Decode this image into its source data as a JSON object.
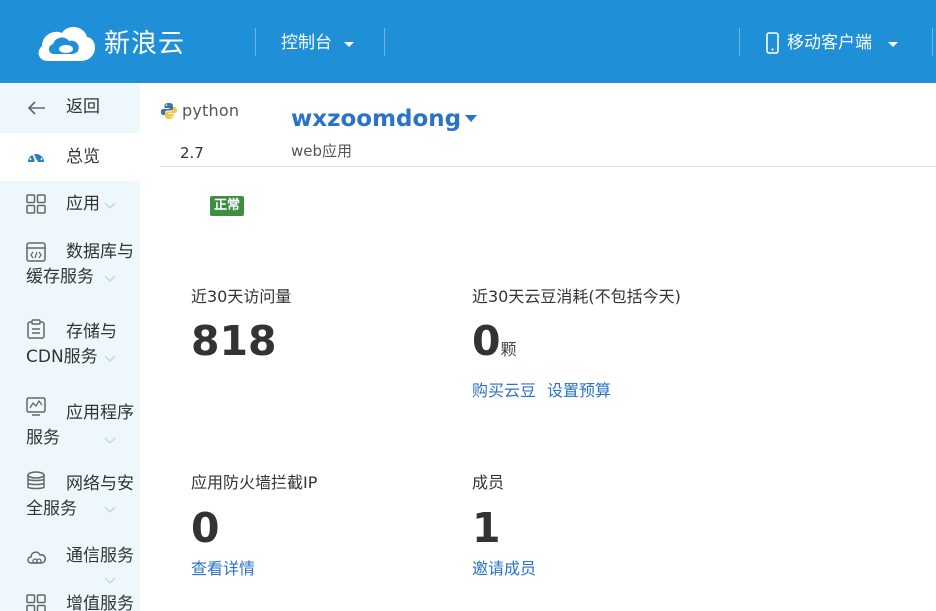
{
  "header": {
    "brand": "新浪云",
    "console_label": "控制台",
    "mobile_label": "移动客户端",
    "bg_color": "#1f8fd8"
  },
  "sidebar": {
    "bg_color": "#eef8fc",
    "items": [
      {
        "label": "返回",
        "icon": "back-arrow-icon"
      },
      {
        "label": "总览",
        "icon": "dashboard-icon",
        "active": true
      },
      {
        "label": "应用",
        "icon": "grid-icon"
      },
      {
        "label_line1": "数据库与",
        "label_line2": "缓存服务",
        "icon": "database-code-icon"
      },
      {
        "label_line1": "存储与",
        "label_line2": "CDN服务",
        "icon": "clipboard-icon"
      },
      {
        "label_line1": "应用程序",
        "label_line2": "服务",
        "icon": "chart-monitor-icon"
      },
      {
        "label_line1": "网络与安",
        "label_line2": "全服务",
        "icon": "database-stack-icon"
      },
      {
        "label": "通信服务",
        "icon": "cloud-link-icon"
      },
      {
        "label": "增值服务",
        "icon": "grid-icon"
      }
    ]
  },
  "app": {
    "runtime": "python",
    "version": "2.7",
    "name": "wxzoomdong",
    "type": "web应用",
    "status": "正常",
    "status_color": "#3e8d40",
    "link_color": "#2a73c5"
  },
  "stats": {
    "visits_label": "近30天访问量",
    "visits_value": "818",
    "beans_label": "近30天云豆消耗(不包括今天)",
    "beans_value": "0",
    "beans_unit": "颗",
    "buy_beans": "购买云豆",
    "set_budget": "设置预算",
    "firewall_label": "应用防火墙拦截IP",
    "firewall_value": "0",
    "view_details": "查看详情",
    "members_label": "成员",
    "members_value": "1",
    "invite_members": "邀请成员"
  }
}
